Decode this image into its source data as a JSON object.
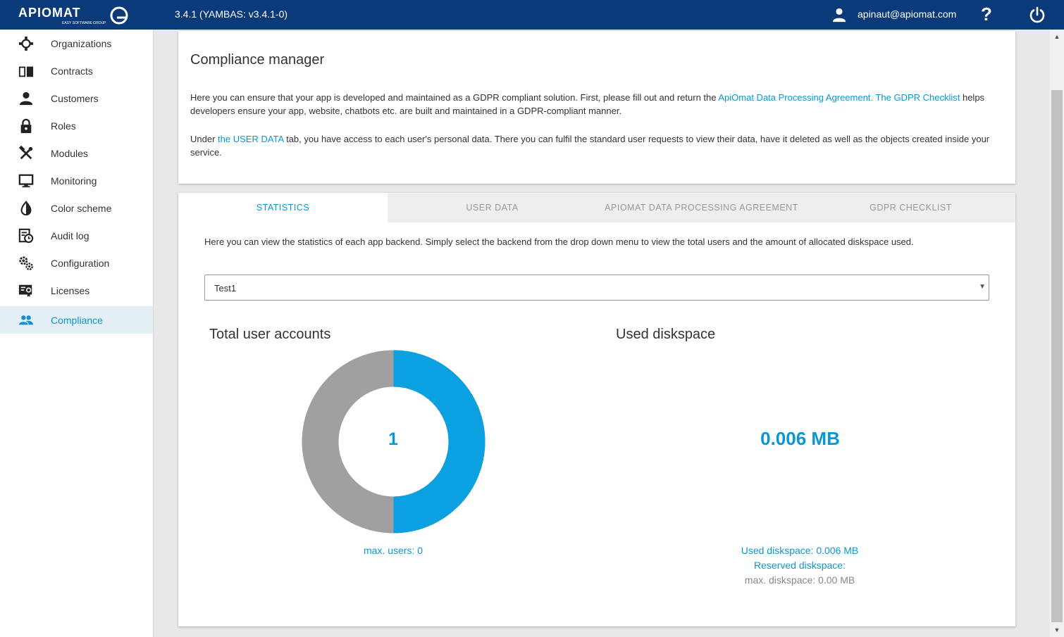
{
  "header": {
    "logo_text": "APIOMAT",
    "logo_subtext": "EASY SOFTWARE GROUP",
    "version": "3.4.1 (YAMBAS: v3.4.1-0)",
    "user_email": "apinaut@apiomat.com",
    "help_label": "?",
    "bg_color": "#0b3a7a"
  },
  "sidebar": {
    "items": [
      {
        "label": "Organizations",
        "icon": "organizations-icon"
      },
      {
        "label": "Contracts",
        "icon": "book-icon"
      },
      {
        "label": "Customers",
        "icon": "person-icon"
      },
      {
        "label": "Roles",
        "icon": "lock-icon"
      },
      {
        "label": "Modules",
        "icon": "tools-icon"
      },
      {
        "label": "Monitoring",
        "icon": "monitor-icon"
      },
      {
        "label": "Color scheme",
        "icon": "contrast-icon"
      },
      {
        "label": "Audit log",
        "icon": "audit-log-icon"
      },
      {
        "label": "Configuration",
        "icon": "gears-icon"
      },
      {
        "label": "Licenses",
        "icon": "license-icon"
      },
      {
        "label": "Compliance",
        "icon": "people-icon",
        "active": true
      }
    ]
  },
  "intro": {
    "title": "Compliance manager",
    "p1_pre": "Here you can ensure that your app is developed and maintained as a GDPR compliant solution. First, please fill out and return the ",
    "p1_link1": "ApiOmat Data Processing Agreement",
    "p1_sep": ". ",
    "p1_link2": "The GDPR Checklist",
    "p1_post": " helps developers ensure your app, website, chatbots etc. are built and maintained in a GDPR-compliant manner.",
    "p2_pre": "Under ",
    "p2_link": "the USER DATA",
    "p2_post": " tab, you have access to each user's personal data. There you can fulfil the standard user requests to view their data, have it deleted as well as the objects created inside your service."
  },
  "tabs": [
    {
      "label": "STATISTICS",
      "active": true
    },
    {
      "label": "USER DATA"
    },
    {
      "label": "APIOMAT DATA PROCESSING AGREEMENT"
    },
    {
      "label": "GDPR CHECKLIST"
    }
  ],
  "statistics": {
    "description": "Here you can view the statistics of each app backend. Simply select the backend from the drop down menu to view the total users and the amount of allocated diskspace used.",
    "backend_select": {
      "value": "Test1"
    },
    "users": {
      "title": "Total user accounts",
      "count": "1",
      "max_label": "max. users: 0",
      "filled_fraction": 0.5,
      "fill_color": "#0ba0e0",
      "rest_color": "#a0a0a0"
    },
    "disk": {
      "title": "Used diskspace",
      "value": "0.006 MB",
      "used_label": "Used diskspace: 0.006 MB",
      "reserved_label": "Reserved diskspace:",
      "max_label": "max. diskspace: 0.00 MB"
    }
  }
}
